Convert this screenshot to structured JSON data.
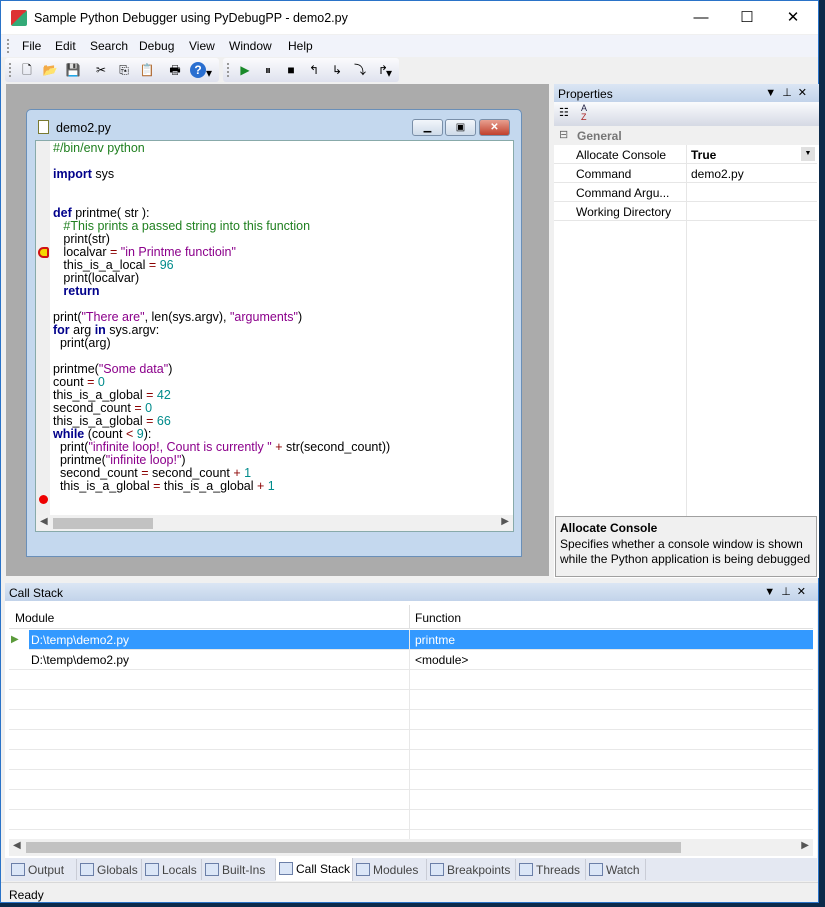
{
  "window": {
    "title": "Sample Python Debugger using PyDebugPP - demo2.py",
    "minimize": "—",
    "maximize": "☐",
    "close": "✕"
  },
  "menu": [
    "File",
    "Edit",
    "Search",
    "Debug",
    "View",
    "Window",
    "Help"
  ],
  "toolbar1": [
    {
      "icon": "new-file-icon",
      "glyph": "🗋"
    },
    {
      "icon": "open-folder-icon",
      "glyph": "📂"
    },
    {
      "icon": "save-icon",
      "glyph": "💾"
    },
    {
      "icon": "cut-icon",
      "glyph": "✂"
    },
    {
      "icon": "copy-icon",
      "glyph": "⎘"
    },
    {
      "icon": "paste-icon",
      "glyph": "📋"
    },
    {
      "icon": "print-icon",
      "glyph": "🖶"
    },
    {
      "icon": "help-icon",
      "glyph": "?"
    }
  ],
  "toolbar2": [
    {
      "icon": "run-icon",
      "glyph": "▶"
    },
    {
      "icon": "pause-icon",
      "glyph": "⏸"
    },
    {
      "icon": "stop-icon",
      "glyph": "■"
    },
    {
      "icon": "restart-icon",
      "glyph": "↰"
    },
    {
      "icon": "step-into-icon",
      "glyph": "↳"
    },
    {
      "icon": "step-over-icon",
      "glyph": "⤵"
    },
    {
      "icon": "step-out-icon",
      "glyph": "↱"
    }
  ],
  "editor": {
    "title": "demo2.py",
    "current_line": 8,
    "breakpoint_line": 27,
    "lines": [
      [
        [
          "#/bin/env python",
          "cm"
        ]
      ],
      [],
      [
        [
          "import",
          "kw"
        ],
        [
          " sys",
          ""
        ]
      ],
      [],
      [],
      [
        [
          "def",
          "kw"
        ],
        [
          " printme( str ):",
          ""
        ]
      ],
      [
        [
          "   #This prints a passed string into this function",
          "cm"
        ]
      ],
      [
        [
          "   print(str)",
          ""
        ]
      ],
      [
        [
          "   localvar ",
          ""
        ],
        [
          "=",
          "op"
        ],
        [
          " ",
          ""
        ],
        [
          "\"in Printme functioin\"",
          "st"
        ]
      ],
      [
        [
          "   this_is_a_local ",
          ""
        ],
        [
          "=",
          "op"
        ],
        [
          " ",
          ""
        ],
        [
          "96",
          "nm"
        ]
      ],
      [
        [
          "   print(localvar)",
          ""
        ]
      ],
      [
        [
          "   ",
          ""
        ],
        [
          "return",
          "kw"
        ]
      ],
      [],
      [
        [
          "print(",
          ""
        ],
        [
          "\"There are\"",
          "st"
        ],
        [
          ", len(sys.argv), ",
          ""
        ],
        [
          "\"arguments\"",
          "st"
        ],
        [
          ")",
          ""
        ]
      ],
      [
        [
          "for",
          "kw"
        ],
        [
          " arg ",
          ""
        ],
        [
          "in",
          "kw"
        ],
        [
          " sys.argv:",
          ""
        ]
      ],
      [
        [
          "  print(arg)",
          ""
        ]
      ],
      [],
      [
        [
          "printme(",
          ""
        ],
        [
          "\"Some data\"",
          "st"
        ],
        [
          ")",
          ""
        ]
      ],
      [
        [
          "count ",
          ""
        ],
        [
          "=",
          "op"
        ],
        [
          " ",
          ""
        ],
        [
          "0",
          "nm"
        ]
      ],
      [
        [
          "this_is_a_global ",
          ""
        ],
        [
          "=",
          "op"
        ],
        [
          " ",
          ""
        ],
        [
          "42",
          "nm"
        ]
      ],
      [
        [
          "second_count ",
          ""
        ],
        [
          "=",
          "op"
        ],
        [
          " ",
          ""
        ],
        [
          "0",
          "nm"
        ]
      ],
      [
        [
          "this_is_a_global ",
          ""
        ],
        [
          "=",
          "op"
        ],
        [
          " ",
          ""
        ],
        [
          "66",
          "nm"
        ]
      ],
      [
        [
          "while",
          "kw"
        ],
        [
          " (count ",
          ""
        ],
        [
          "<",
          "op"
        ],
        [
          " ",
          ""
        ],
        [
          "9",
          "nm"
        ],
        [
          "):",
          ""
        ]
      ],
      [
        [
          "  print(",
          ""
        ],
        [
          "\"infinite loop!, Count is currently \"",
          "st"
        ],
        [
          " ",
          ""
        ],
        [
          "+",
          "op"
        ],
        [
          " str(second_count))",
          ""
        ]
      ],
      [
        [
          "  printme(",
          ""
        ],
        [
          "\"infinite loop!\"",
          "st"
        ],
        [
          ")",
          ""
        ]
      ],
      [
        [
          "  second_count ",
          ""
        ],
        [
          "=",
          "op"
        ],
        [
          " second_count ",
          ""
        ],
        [
          "+",
          "op"
        ],
        [
          " ",
          ""
        ],
        [
          "1",
          "nm"
        ]
      ],
      [
        [
          "  this_is_a_global ",
          ""
        ],
        [
          "=",
          "op"
        ],
        [
          " this_is_a_global ",
          ""
        ],
        [
          "+",
          "op"
        ],
        [
          " ",
          ""
        ],
        [
          "1",
          "nm"
        ]
      ]
    ]
  },
  "properties": {
    "title": "Properties",
    "category": "General",
    "rows": [
      {
        "key": "Allocate Console",
        "value": "True"
      },
      {
        "key": "Command",
        "value": "demo2.py"
      },
      {
        "key": "Command Argu...",
        "value": ""
      },
      {
        "key": "Working Directory",
        "value": ""
      }
    ],
    "desc_title": "Allocate Console",
    "desc_text": "Specifies whether a console window is shown while the Python application is being debugged"
  },
  "callstack": {
    "title": "Call Stack",
    "columns": [
      "Module",
      "Function"
    ],
    "rows": [
      {
        "module": "D:\\temp\\demo2.py",
        "function": "printme",
        "selected": true
      },
      {
        "module": "D:\\temp\\demo2.py",
        "function": "<module>",
        "selected": false
      }
    ]
  },
  "tabs": [
    {
      "label": "Output"
    },
    {
      "label": "Globals"
    },
    {
      "label": "Locals"
    },
    {
      "label": "Built-Ins"
    },
    {
      "label": "Call Stack",
      "active": true
    },
    {
      "label": "Modules"
    },
    {
      "label": "Breakpoints"
    },
    {
      "label": "Threads"
    },
    {
      "label": "Watch"
    }
  ],
  "status": "Ready",
  "colors": {
    "selection": "#3399ff",
    "keyword": "#00008b",
    "comment": "#208020",
    "string": "#8b008b",
    "number": "#008b8b",
    "operator": "#8b0000"
  }
}
